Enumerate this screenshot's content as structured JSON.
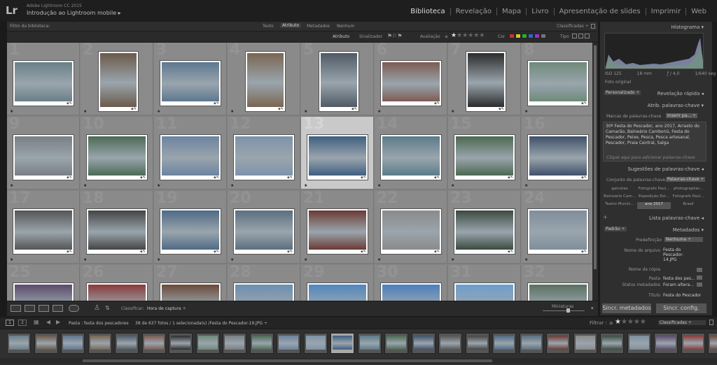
{
  "app": {
    "logo": "Lr",
    "version": "Adobe Lightroom CC 2015",
    "intro": "Introdução ao Lightroom mobile ▸",
    "modules": [
      "Biblioteca",
      "Revelação",
      "Mapa",
      "Livro",
      "Apresentação de slides",
      "Imprimir",
      "Web"
    ],
    "active_module": "Biblioteca"
  },
  "filter_bar": {
    "label": "Filtro da biblioteca:",
    "tabs": [
      "Texto",
      "Atributo",
      "Metadados",
      "Nenhum"
    ],
    "active_tab": "Atributo",
    "preset": "Classificadas ÷"
  },
  "attribute_bar": {
    "label": "Atributo",
    "flag_label": "Sinalizador",
    "rating_label": "Avaliação",
    "rating_op": "≥",
    "color_label": "Cor",
    "type_label": "Tipo",
    "color_swatches": [
      "#cc3333",
      "#cccc33",
      "#33aa33",
      "#3366cc",
      "#9933cc",
      "#777777"
    ]
  },
  "grid": {
    "cells": [
      {
        "n": "1",
        "c": "#6a7f88",
        "orient": "l"
      },
      {
        "n": "2",
        "c": "#6b5a4a",
        "orient": "p"
      },
      {
        "n": "3",
        "c": "#5d7890",
        "orient": "l"
      },
      {
        "n": "4",
        "c": "#7a6652",
        "orient": "p"
      },
      {
        "n": "5",
        "c": "#4f5a66",
        "orient": "p"
      },
      {
        "n": "6",
        "c": "#7d5c52",
        "orient": "l"
      },
      {
        "n": "7",
        "c": "#2c2c2c",
        "orient": "p"
      },
      {
        "n": "8",
        "c": "#6e8a7a",
        "orient": "l"
      },
      {
        "n": "9",
        "c": "#7a7f85",
        "orient": "l"
      },
      {
        "n": "10",
        "c": "#4c6a55",
        "orient": "l"
      },
      {
        "n": "11",
        "c": "#6c83a0",
        "orient": "l"
      },
      {
        "n": "12",
        "c": "#7e93aa",
        "orient": "l"
      },
      {
        "n": "13",
        "c": "#3f5f80",
        "orient": "l"
      },
      {
        "n": "14",
        "c": "#5a7c8a",
        "orient": "l"
      },
      {
        "n": "15",
        "c": "#4d6850",
        "orient": "l"
      },
      {
        "n": "16",
        "c": "#40506a",
        "orient": "l"
      },
      {
        "n": "17",
        "c": "#555555",
        "orient": "l"
      },
      {
        "n": "18",
        "c": "#444444",
        "orient": "l"
      },
      {
        "n": "19",
        "c": "#4f6a85",
        "orient": "l"
      },
      {
        "n": "20",
        "c": "#5b6f80",
        "orient": "l"
      },
      {
        "n": "21",
        "c": "#6a3a34",
        "orient": "l"
      },
      {
        "n": "22",
        "c": "#8a8a8a",
        "orient": "l"
      },
      {
        "n": "23",
        "c": "#3b4b40",
        "orient": "l"
      },
      {
        "n": "24",
        "c": "#7f8e9b",
        "orient": "l"
      },
      {
        "n": "25",
        "c": "#5a4a6a",
        "orient": "l"
      },
      {
        "n": "26",
        "c": "#8a3a3a",
        "orient": "l"
      },
      {
        "n": "27",
        "c": "#6a4a3a",
        "orient": "l"
      },
      {
        "n": "28",
        "c": "#6b8fb0",
        "orient": "l"
      },
      {
        "n": "29",
        "c": "#4f86c0",
        "orient": "l"
      },
      {
        "n": "30",
        "c": "#4a7fbf",
        "orient": "l"
      },
      {
        "n": "31",
        "c": "#6b9fd0",
        "orient": "l"
      },
      {
        "n": "32",
        "c": "#5a7060",
        "orient": "l"
      }
    ],
    "selected": "13"
  },
  "toolbar": {
    "sort_label": "Classificar:",
    "sort_value": "Hora de captura ÷",
    "thumb_label": "Miniaturas"
  },
  "right_panel": {
    "histogram": "Histograma ▾",
    "hist_info": [
      "ISO 125",
      "18 mm",
      "ƒ / 4,0",
      "1/640 seg"
    ],
    "original": "Foto original",
    "quick_preset": "Personalizado ÷",
    "quick_dev": "Revelação rápida ◂",
    "kw_tag_header": "Atrib. palavras-chave ▾",
    "kw_marks_label": "Marcas de palavras-chave",
    "kw_marks_value": "Inserir pa... ÷",
    "kw_text": "30ª Festa do Pescador, ano 2017, Arrasto do Camarão, Balneário Camboriú, Festa do Pescador, Peixe, Pesca, Pesca artesanal, Pescador, Praia Central, Salga",
    "kw_hint": "Clique aqui para adicionar palavras-chave",
    "kw_suggest": "Sugestões de palavras-chave ◂",
    "kw_set_label": "Conjunto de palavras-chave",
    "kw_set_value": "Palavras-chave ÷",
    "kw_set_items": [
      "gaivotas",
      "Fotógrafo Paul...",
      "photographer...",
      "Balneário Cam...",
      "Expedição Est...",
      "Fotógrafo Paul...",
      "Teatro Munici...",
      "ano 2017",
      "Brasil"
    ],
    "kw_list": "Lista palavras-chave ◂",
    "meta_preset": "Padrão ÷",
    "meta_header": "Metadados ▾",
    "predef_label": "Predefinição",
    "predef_value": "Nenhuma ÷",
    "fields": [
      {
        "label": "Nome do arquivo",
        "value": "Festa do Pescador-14.JPG"
      },
      {
        "label": "Nome da cópia",
        "value": ""
      },
      {
        "label": "Pasta",
        "value": "festa dos pes..."
      },
      {
        "label": "Status metadados",
        "value": "Foram altera..."
      },
      {
        "label": "Título",
        "value": "Festa do Pescador"
      }
    ],
    "sync_meta": "Sincr. metadados",
    "sync_settings": "Sincr. config."
  },
  "status": {
    "page1": "1",
    "page2": "2",
    "path": "Pasta : festa dos pescadores",
    "count": "38 de 637 fotos / 1 selecionada(s) /Festa do Pescador-19.JPG ÷",
    "filter_label": "Filtrar :",
    "filter_op": "≥",
    "filter_value": "Classificadas ÷"
  },
  "filmstrip": [
    "#6a7f88",
    "#6b5a4a",
    "#5d7890",
    "#7a6652",
    "#4f5a66",
    "#7d5c52",
    "#2c2c2c",
    "#6e8a7a",
    "#7a7f85",
    "#4c6a55",
    "#6c83a0",
    "#7e93aa",
    "#3f5f80",
    "#5a7c8a",
    "#4d6850",
    "#40506a",
    "#555555",
    "#444444",
    "#4f6a85",
    "#5b6f80",
    "#6a3a34",
    "#8a8a8a",
    "#3b4b40",
    "#7f8e9b",
    "#5a4a6a",
    "#8a3a3a",
    "#6a4a3a"
  ]
}
